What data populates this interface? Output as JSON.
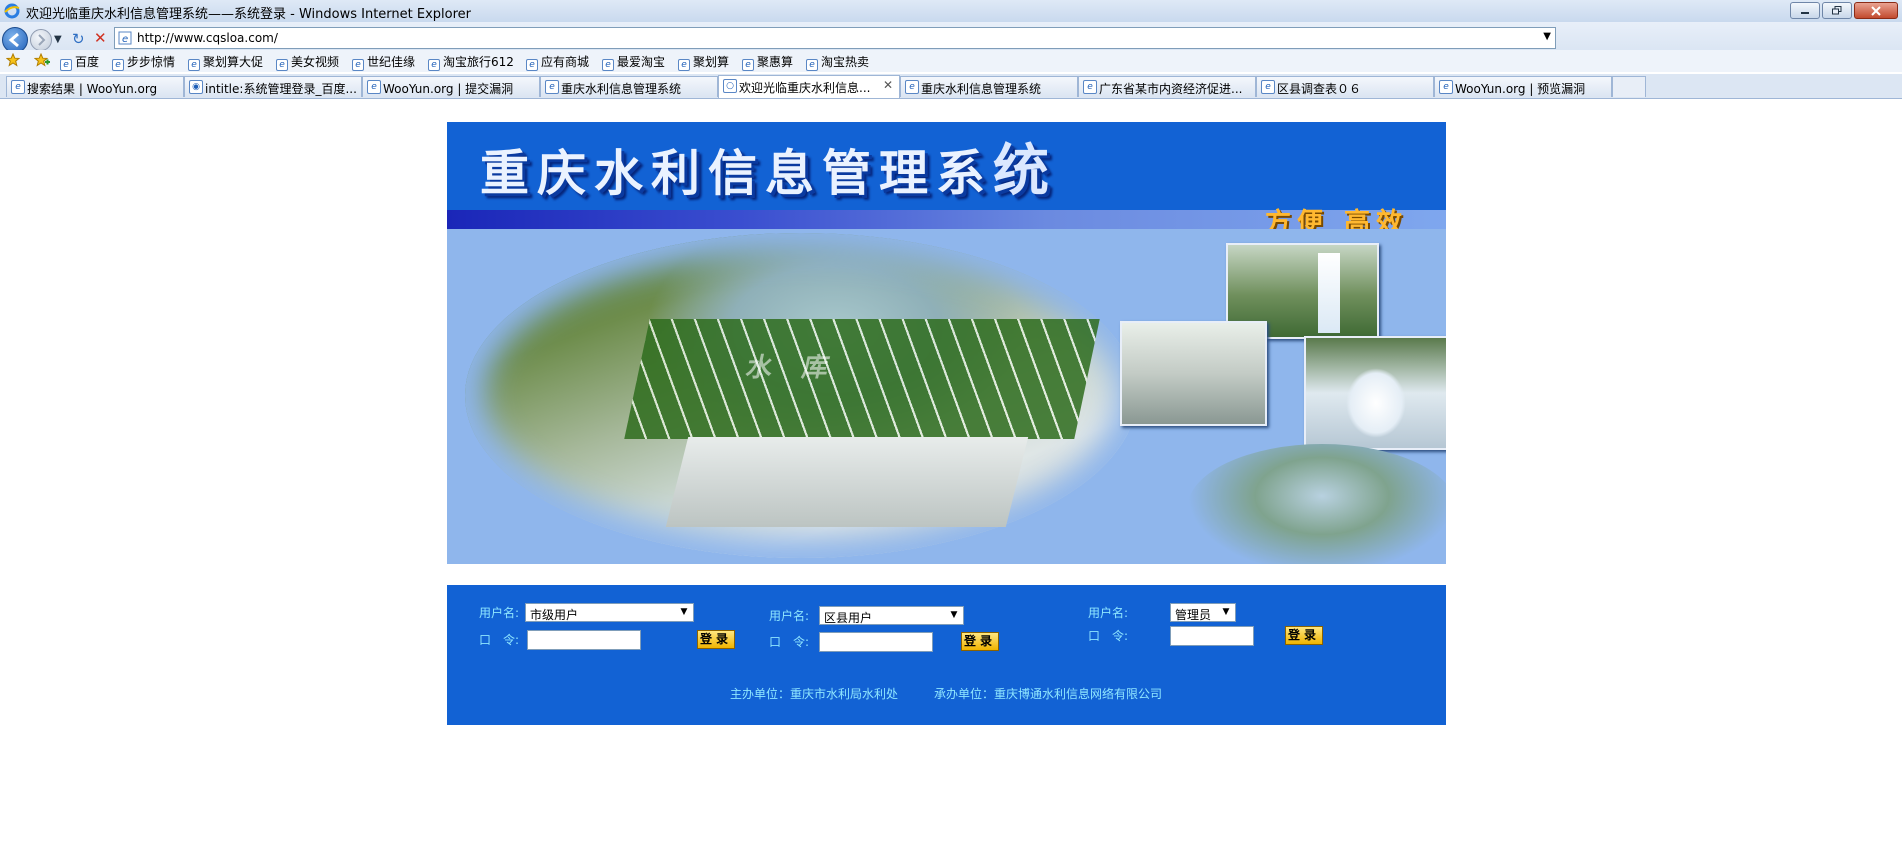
{
  "window": {
    "title": "欢迎光临重庆水利信息管理系统——系统登录 - Windows Internet Explorer"
  },
  "address_bar": {
    "url": "http://www.cqsloa.com/"
  },
  "favorites": [
    {
      "label": "百度"
    },
    {
      "label": "步步惊情"
    },
    {
      "label": "聚划算大促"
    },
    {
      "label": "美女视频"
    },
    {
      "label": "世纪佳缘"
    },
    {
      "label": "淘宝旅行612"
    },
    {
      "label": "应有商城"
    },
    {
      "label": "最爱淘宝"
    },
    {
      "label": "聚划算"
    },
    {
      "label": "聚惠算"
    },
    {
      "label": "淘宝热卖"
    }
  ],
  "tabs": [
    {
      "label": "搜索结果 | WooYun.org"
    },
    {
      "label": "intitle:系统管理登录_百度..."
    },
    {
      "label": "WooYun.org | 提交漏洞"
    },
    {
      "label": "重庆水利信息管理系统"
    },
    {
      "label": "欢迎光临重庆水利信息...",
      "active": true
    },
    {
      "label": "重庆水利信息管理系统"
    },
    {
      "label": "广东省某市内资经济促进..."
    },
    {
      "label": "区县调查表０６"
    },
    {
      "label": "WooYun.org | 预览漏洞"
    }
  ],
  "page": {
    "logo_text": "重庆水利信息管理系",
    "logo_text_last": "统",
    "slogan": "方便 高效",
    "reservoir_text": "水库"
  },
  "login": {
    "city": {
      "username_label": "用户名:",
      "password_label": "口　令:",
      "user_select_value": "市级用户",
      "password_value": "",
      "submit_label": "登录"
    },
    "county": {
      "username_label": "用户名:",
      "password_label": "口　令:",
      "user_select_value": "区县用户",
      "password_value": "",
      "submit_label": "登录"
    },
    "admin": {
      "username_label": "用户名:",
      "password_label": "口　令:",
      "user_select_value": "管理员",
      "password_value": "",
      "submit_label": "登录"
    }
  },
  "footer": {
    "host": "主办单位：重庆市水利局水利处",
    "organizer": "承办单位：重庆博通水利信息网络有限公司"
  },
  "colors": {
    "page_blue": "#1262d4",
    "label_cyan": "#8fe6ff",
    "button_yellow": "#f0b400"
  }
}
